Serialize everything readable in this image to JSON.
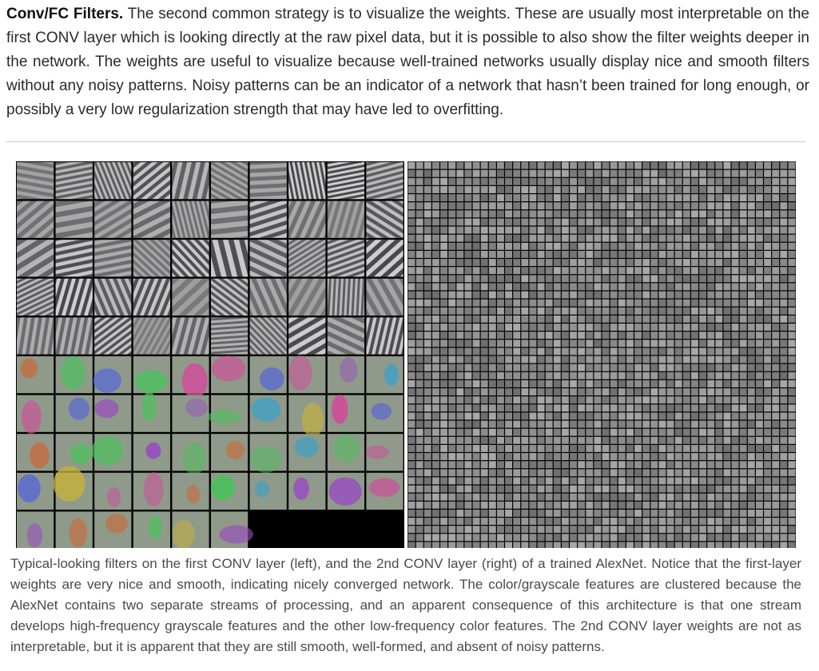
{
  "section": {
    "heading": "Conv/FC Filters.",
    "body": " The second common strategy is to visualize the weights. These are usually most interpretable on the first CONV layer which is looking directly at the raw pixel data, but it is possible to also show the filter weights deeper in the network. The weights are useful to visualize because well-trained networks usually display nice and smooth filters without any noisy patterns. Noisy patterns can be an indicator of a network that hasn’t been trained for long enough, or possibly a very low regularization strength that may have led to overfitting."
  },
  "figure": {
    "caption": "Typical-looking filters on the first CONV layer (left), and the 2nd CONV layer (right) of a trained AlexNet. Notice that the first-layer weights are very nice and smooth, indicating nicely converged network. The color/grayscale features are clustered because the AlexNet contains two separate streams of processing, and an apparent consequence of this architecture is that one stream develops high-frequency grayscale features and the other low-frequency color features. The 2nd CONV layer weights are not as interpretable, but it is apparent that they are still smooth, well-formed, and absent of noisy patterns."
  },
  "colors": {
    "text": "#2a2a2a",
    "caption_text": "#4a4a4a",
    "divider": "#c8c8c8",
    "figure_background": "#000000",
    "filter_gray": "#8c8c8c"
  }
}
